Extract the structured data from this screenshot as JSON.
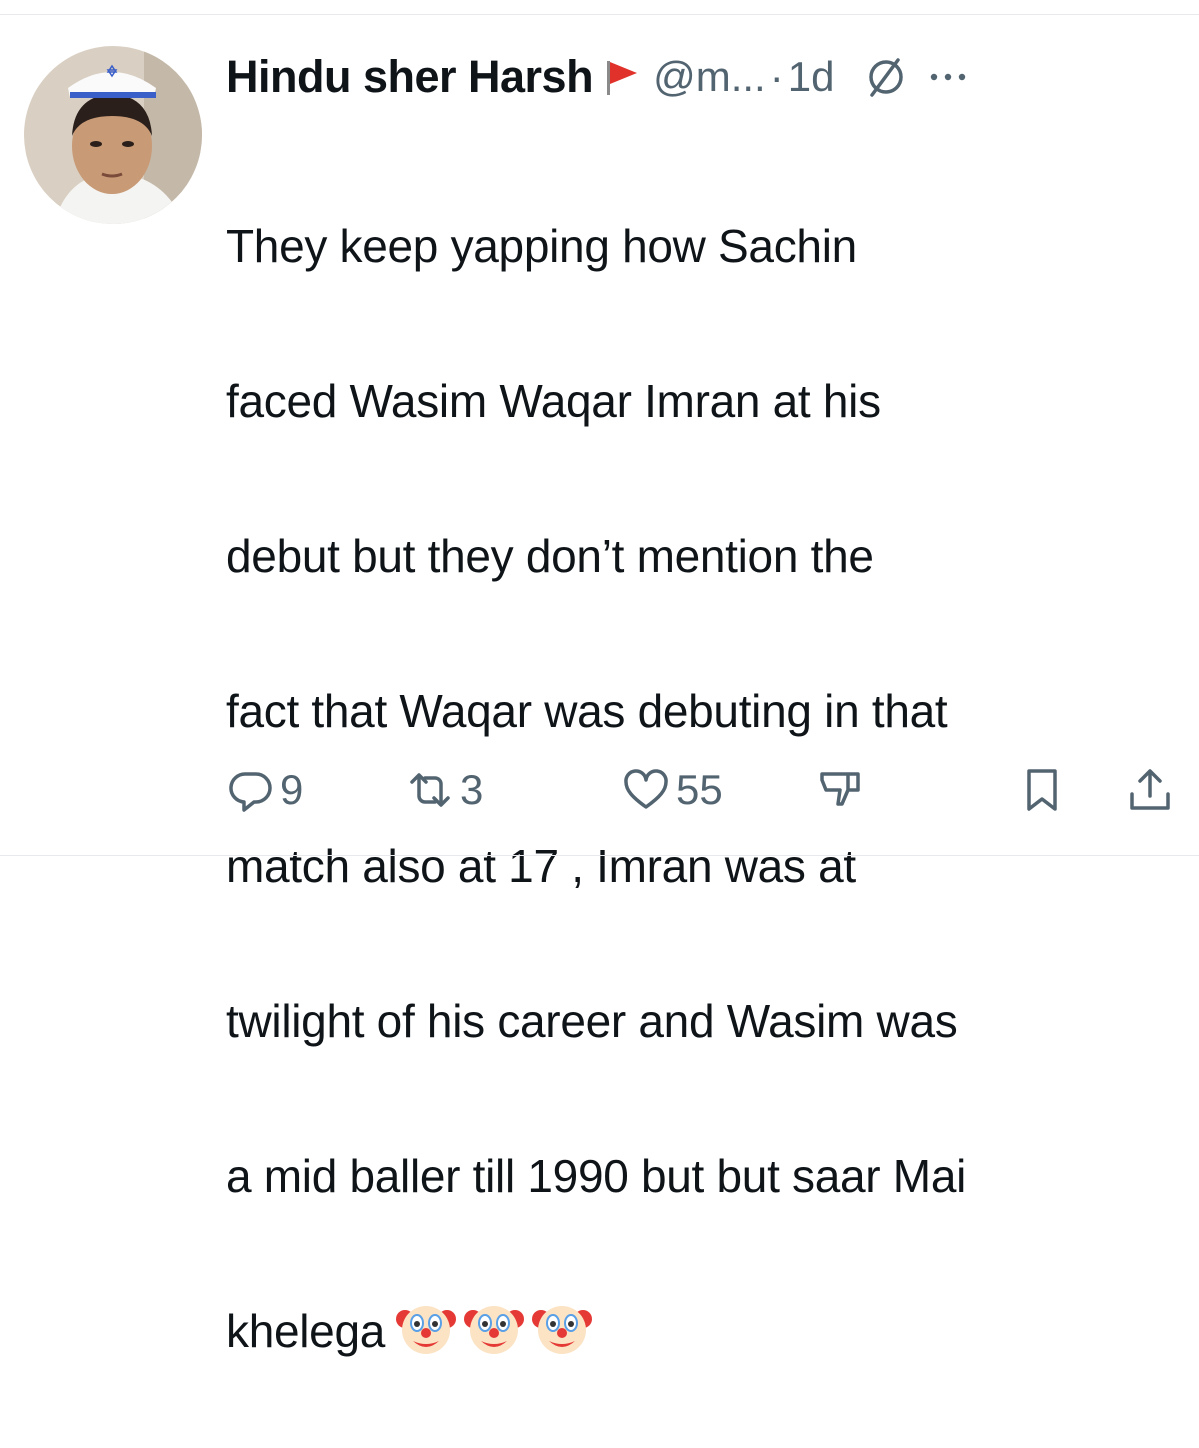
{
  "tweet": {
    "display_name": "Hindu sher Harsh",
    "handle": "@m...",
    "separator": "·",
    "time": "1d",
    "flag_icon": "red-flag-icon",
    "text_lines": [
      "They keep yapping how Sachin",
      "faced Wasim Waqar Imran at his",
      "debut but they don’t mention the",
      "fact that Waqar was debuting in that",
      "match also at 17 , Imran was at",
      "twilight of his career and Wasim was",
      "a mid baller till 1990 but but saar Mai",
      "khelega"
    ],
    "emojis": [
      "clown-face-emoji",
      "clown-face-emoji",
      "clown-face-emoji"
    ]
  },
  "actions": {
    "replies": "9",
    "reposts": "3",
    "likes": "55"
  },
  "colors": {
    "text": "#0f1419",
    "muted": "#536471",
    "flag": "#e0322b",
    "divider": "#e7e9ec"
  }
}
